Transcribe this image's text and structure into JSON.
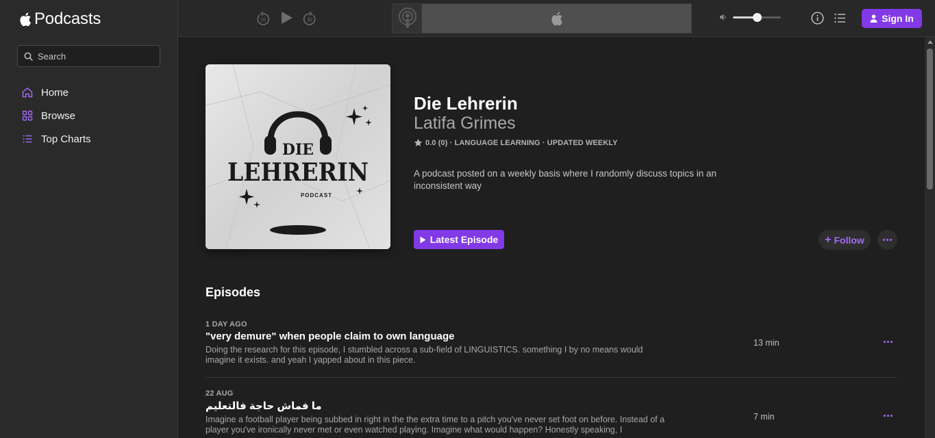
{
  "app": {
    "brand": "Podcasts",
    "search_placeholder": "Search"
  },
  "sidebar": {
    "items": [
      {
        "label": "Home",
        "icon": "home-icon"
      },
      {
        "label": "Browse",
        "icon": "grid-icon"
      },
      {
        "label": "Top Charts",
        "icon": "list-icon"
      }
    ]
  },
  "player": {
    "skip_back_label": "15",
    "skip_forward_label": "30",
    "volume_level": 0.5,
    "signin_label": "Sign In"
  },
  "podcast": {
    "title": "Die Lehrerin",
    "author": "Latifa Grimes",
    "meta": "0.0 (0) · LANGUAGE LEARNING · UPDATED WEEKLY",
    "description": "A podcast posted on a weekly basis where I randomly discuss topics in an inconsistent way",
    "latest_episode_label": "Latest Episode",
    "follow_label": "Follow",
    "artwork": {
      "line1": "DIE",
      "line2": "LEHRERIN",
      "line3": "PODCAST"
    }
  },
  "episodes_heading": "Episodes",
  "episodes": [
    {
      "date": "1 DAY AGO",
      "title": "\"very demure\" when people claim to own language",
      "description": "Doing the research for this episode, I stumbled across a sub-field of LINGUISTICS. something I by no means would imagine it exists. and yeah I yapped about in this piece.",
      "duration": "13 min"
    },
    {
      "date": "22 AUG",
      "title": "ما فماش حاجة فالتعليم",
      "description": "Imagine a football player being subbed in right in the the extra time to a pitch you've never set foot on before. Instead of a player you've ironically never met or even watched playing. Imagine what would happen? Honestly speaking, I",
      "duration": "7 min"
    }
  ],
  "colors": {
    "accent": "#8239e6",
    "accent_text": "#a569f7",
    "sidebar_bg": "#2a2a2a",
    "main_bg": "#1f1f1f"
  }
}
